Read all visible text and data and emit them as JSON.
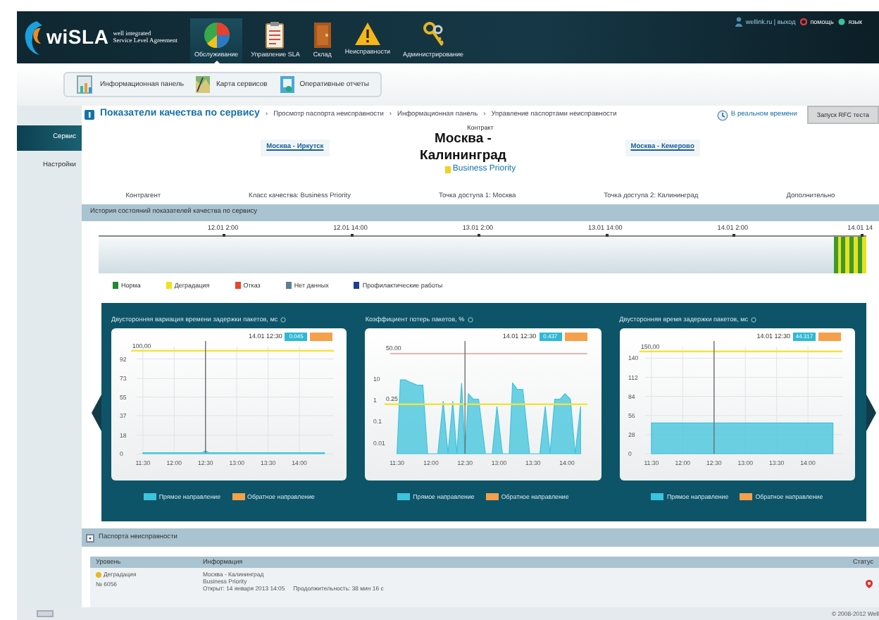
{
  "header": {
    "logo": {
      "name": "wiSLA",
      "tagline_1": "well integrated",
      "tagline_2": "Service Level Agreement"
    },
    "nav": [
      {
        "label": "Обслуживание",
        "selected": true
      },
      {
        "label": "Управление SLA",
        "selected": false
      },
      {
        "label": "Склад",
        "selected": false
      },
      {
        "label": "Неисправности",
        "selected": false
      },
      {
        "label": "Администрирование",
        "selected": false
      }
    ],
    "user": "wellink.ru | выход",
    "help": "помощь",
    "language": "язык"
  },
  "tabs": [
    {
      "label": "Информационная панель"
    },
    {
      "label": "Карта сервисов"
    },
    {
      "label": "Оперативные отчеты"
    }
  ],
  "sidebar": {
    "items": [
      {
        "label": "Сервис",
        "selected": true
      },
      {
        "label": "Настройки",
        "selected": false
      }
    ]
  },
  "breadcrumb": {
    "title": "Показатели качества по сервису",
    "crumbs": [
      {
        "separator": "›",
        "label": "Просмотр паспорта неисправности"
      },
      {
        "separator": "›",
        "label": "Информационная панель"
      },
      {
        "separator": "›",
        "label": "Управление паспортами неисправности"
      }
    ],
    "realtime": "В реальном времени",
    "test_button": "Запуск RFC теста"
  },
  "contract": {
    "label": "Контракт",
    "title": "Москва - Калининград",
    "previous": "Москва - Иркутск",
    "next": "Москва - Кемерово",
    "quality_class": {
      "text": "Business Priority",
      "color": "#f2d024"
    },
    "details": [
      "Контрагент",
      "Класс качества: Business Priority",
      "Точка доступа 1: Москва",
      "Точка доступа 2: Калининград",
      "Дополнительно"
    ]
  },
  "history": {
    "title": "История состояний показателей качества по сервису",
    "ticks": [
      "12.01 2:00",
      "12.01 14:00",
      "13.01 2:00",
      "13.01 14:00",
      "14.01 2:00",
      "14.01 14"
    ],
    "segments": [
      {
        "color": "#3f9a2e"
      },
      {
        "color": "#e6e21c"
      },
      {
        "color": "#3f9a2e"
      },
      {
        "color": "#e6e21c"
      },
      {
        "color": "#3f9a2e"
      },
      {
        "color": "#e6e21c"
      },
      {
        "color": "#3f9a2e"
      },
      {
        "color": "#e6e21c"
      }
    ],
    "legend": [
      {
        "label": "Норма",
        "color": "#1f8a2e"
      },
      {
        "label": "Деградация",
        "color": "#efe21a"
      },
      {
        "label": "Отказ",
        "color": "#e8452c"
      },
      {
        "label": "Нет данных",
        "color": "#5a7e96"
      },
      {
        "label": "Профилактические работы",
        "color": "#1c3f94"
      }
    ]
  },
  "panel": {
    "charts": [
      {
        "title": "Двусторонняя вариация времени задержки пакетов, мс",
        "cursor_time": "14.01 12:30",
        "cursor_value": "0.045",
        "chart_data": {
          "type": "area",
          "grid": true,
          "x": [
            11.5,
            12.45,
            12.5,
            12.55,
            14.4
          ],
          "series": [
            {
              "name": "Прямое направление",
              "color": "#3ec3dc",
              "values": [
                1,
                1,
                3,
                1,
                1
              ]
            },
            {
              "name": "Обратное направление",
              "color": "#f5a04a",
              "values": [
                null,
                null,
                null,
                null,
                null
              ]
            }
          ],
          "xlim": [
            11.4,
            14.55
          ],
          "ylim": [
            0,
            104
          ],
          "yticks": [
            0,
            18,
            37,
            55,
            73,
            92
          ],
          "xticks": [
            {
              "value": 11.5,
              "label": "11:30"
            },
            {
              "value": 12,
              "label": "12:00"
            },
            {
              "value": 12.5,
              "label": "12:30"
            },
            {
              "value": 13,
              "label": "13:00"
            },
            {
              "value": 13.5,
              "label": "13:30"
            },
            {
              "value": 14,
              "label": "14:00"
            }
          ],
          "ref_lines": [
            {
              "axis": "y",
              "value": 100,
              "label": "100.00",
              "color": "#f0e43c"
            },
            {
              "axis": "x",
              "value": 12.5,
              "color": "#6b6f72"
            }
          ]
        }
      },
      {
        "title": "Коэффициент потерь пакетов, %",
        "cursor_time": "14.01 12:30",
        "cursor_value": "0.437",
        "top_label": "50.00",
        "limit_label": "0.25",
        "y_labels": [
          "10",
          "1",
          "0.1",
          "0.01"
        ],
        "x_labels": [
          "11:30",
          "12:00",
          "12:30",
          "13:00",
          "13:30",
          "14:00"
        ],
        "legend": [
          {
            "name": "Прямое направление",
            "color": "#3ec3dc"
          },
          {
            "name": "Обратное направление",
            "color": "#f5a04a"
          }
        ]
      },
      {
        "title": "Двусторонняя время задержки пакетов, мс",
        "cursor_time": "14.01 12:30",
        "cursor_value": "44.317",
        "chart_data": {
          "type": "area",
          "grid": true,
          "x": [
            11.5,
            14.4
          ],
          "series": [
            {
              "name": "Прямое направление",
              "color": "#3ec3dc",
              "values": [
                45,
                45
              ]
            },
            {
              "name": "Обратное направление",
              "color": "#f5a04a",
              "values": [
                null,
                null
              ]
            }
          ],
          "xlim": [
            11.4,
            14.55
          ],
          "ylim": [
            0,
            157
          ],
          "yticks": [
            0,
            28,
            56,
            84,
            112,
            140
          ],
          "xticks": [
            {
              "value": 11.5,
              "label": "11:30"
            },
            {
              "value": 12,
              "label": "12:00"
            },
            {
              "value": 12.5,
              "label": "12:30"
            },
            {
              "value": 13,
              "label": "13:00"
            },
            {
              "value": 13.5,
              "label": "13:30"
            },
            {
              "value": 14,
              "label": "14:00"
            }
          ],
          "ref_lines": [
            {
              "axis": "y",
              "value": 150,
              "label": "150.00",
              "color": "#f0e43c"
            },
            {
              "axis": "x",
              "value": 12.5,
              "color": "#6b6f72"
            }
          ]
        }
      }
    ]
  },
  "passports": {
    "title": "Паспорта неисправности",
    "columns": [
      "Уровень",
      "Информация",
      "Статус"
    ],
    "rows": [
      {
        "level": "Деградация",
        "color": "#e8b820",
        "number": "№ 6056",
        "info": [
          "Москва - Калининград",
          "Business Priority",
          "Открыт: 14 января 2013 14:05"
        ],
        "duration": "Продолжительность: 38 мин 16 с"
      }
    ]
  },
  "footer": {
    "copyright": "© 2008-2012 Well"
  }
}
